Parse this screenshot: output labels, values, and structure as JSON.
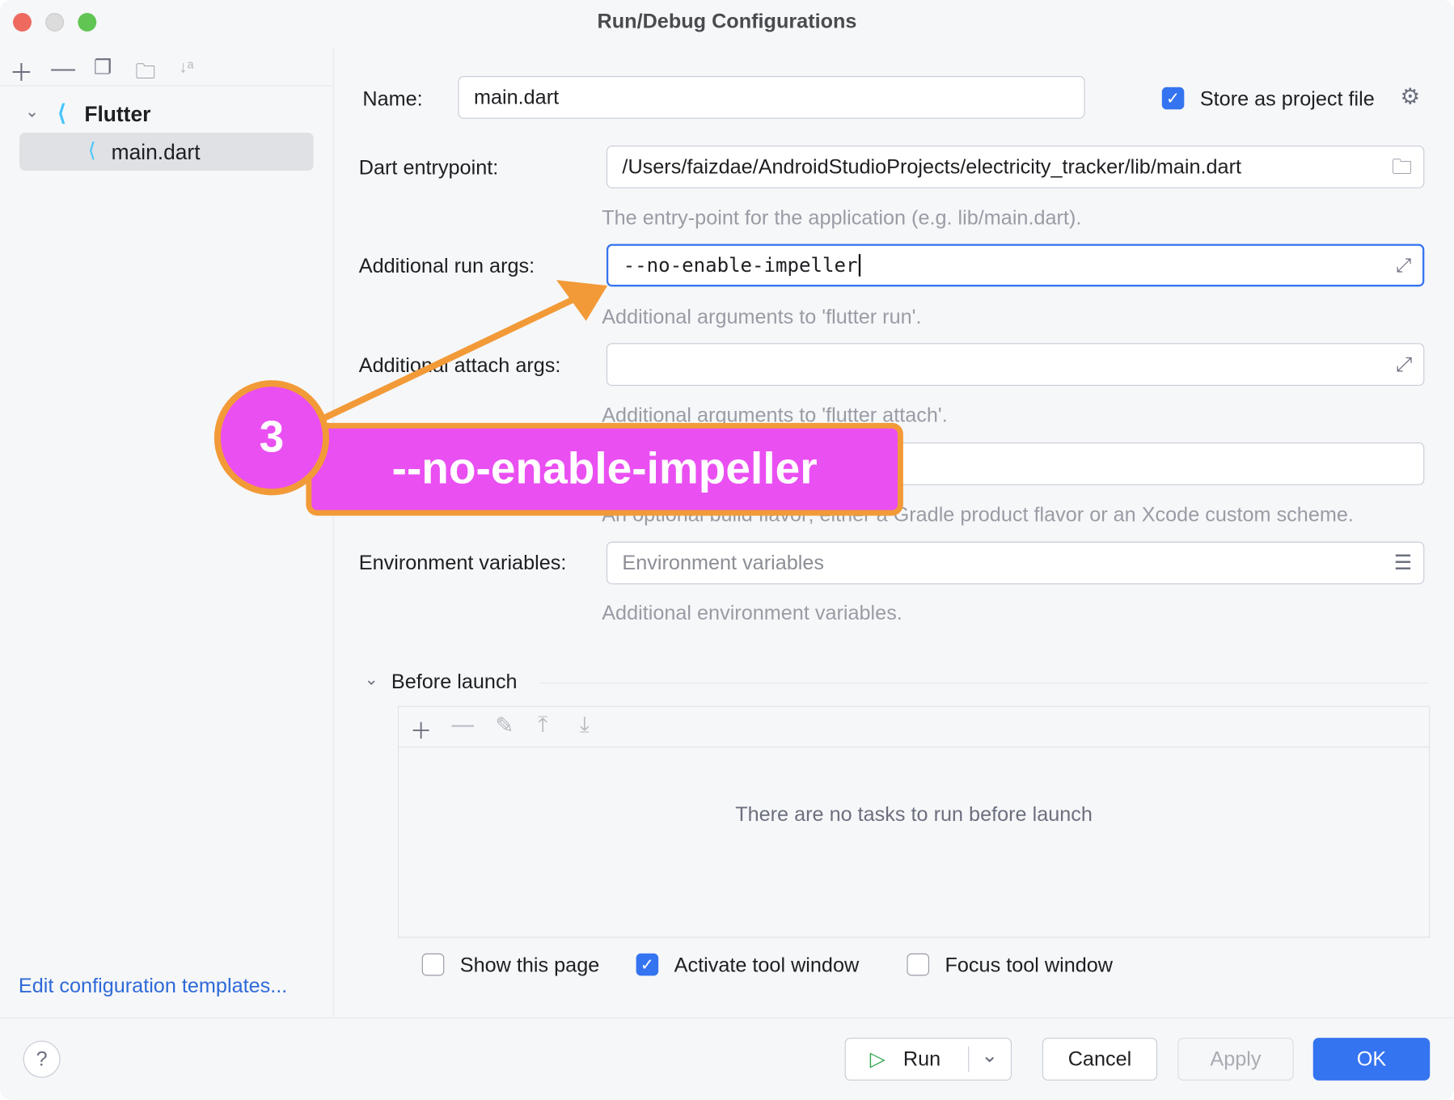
{
  "window": {
    "title": "Run/Debug Configurations"
  },
  "sidebar": {
    "tree": {
      "group": "Flutter",
      "items": [
        {
          "label": "main.dart",
          "selected": true
        }
      ]
    },
    "edit_templates_link": "Edit configuration templates..."
  },
  "form": {
    "name_label": "Name:",
    "name_value": "main.dart",
    "store_label": "Store as project file",
    "store_checked": true,
    "entry_label": "Dart entrypoint:",
    "entry_value": "/Users/faizdae/AndroidStudioProjects/electricity_tracker/lib/main.dart",
    "entry_hint": "The entry-point for the application (e.g. lib/main.dart).",
    "run_args_label": "Additional run args:",
    "run_args_value": "--no-enable-impeller",
    "run_args_hint": "Additional arguments to 'flutter run'.",
    "attach_label": "Additional attach args:",
    "attach_value": "",
    "attach_hint": "Additional arguments to 'flutter attach'.",
    "flavor_hint": "An optional build flavor; either a Gradle product flavor or an Xcode custom scheme.",
    "env_label": "Environment variables:",
    "env_placeholder": "Environment variables",
    "env_hint": "Additional environment variables."
  },
  "before_launch": {
    "title": "Before launch",
    "empty": "There are no tasks to run before launch"
  },
  "options": [
    {
      "label": "Show this page",
      "checked": false
    },
    {
      "label": "Activate tool window",
      "checked": true
    },
    {
      "label": "Focus tool window",
      "checked": false
    }
  ],
  "footer": {
    "help": "?",
    "run": "Run",
    "cancel": "Cancel",
    "apply": "Apply",
    "ok": "OK"
  },
  "annotation": {
    "step": "3",
    "text": "--no-enable-impeller",
    "fill": "#ea4ff2",
    "stroke": "#f29a38"
  },
  "colors": {
    "accent": "#3574f0"
  }
}
